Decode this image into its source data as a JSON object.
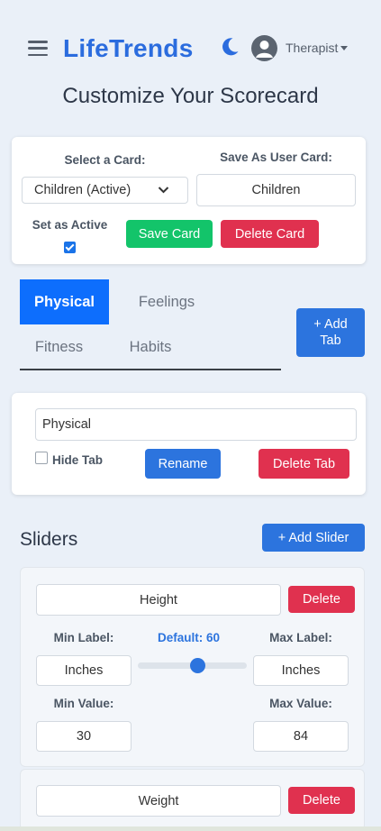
{
  "header": {
    "brand": "LifeTrends",
    "role": "Therapist",
    "menu_icon": "hamburger-menu-icon",
    "theme_icon": "moon-icon",
    "avatar_icon": "user-avatar-icon"
  },
  "page_title": "Customize Your Scorecard",
  "card_panel": {
    "select_label": "Select a Card:",
    "select_value": "Children (Active)",
    "save_as_label": "Save As User Card:",
    "save_as_value": "Children",
    "set_active_label": "Set as Active",
    "set_active_checked": true,
    "save_button": "Save Card",
    "delete_button": "Delete Card"
  },
  "tabs": {
    "items": [
      "Physical",
      "Feelings",
      "Fitness",
      "Habits"
    ],
    "active": "Physical",
    "add_tab_line1": "+ Add",
    "add_tab_line2": "Tab"
  },
  "tab_panel": {
    "name_value": "Physical",
    "hide_label": "Hide Tab",
    "hide_checked": false,
    "rename_button": "Rename",
    "delete_button": "Delete Tab"
  },
  "sliders": {
    "title": "Sliders",
    "add_button": "+ Add Slider",
    "items": [
      {
        "name": "Height",
        "delete_button": "Delete",
        "min_label_caption": "Min Label:",
        "default_caption": "Default: 60",
        "default_value": 60,
        "max_label_caption": "Max Label:",
        "min_label": "Inches",
        "max_label": "Inches",
        "min_value_caption": "Min Value:",
        "max_value_caption": "Max Value:",
        "min_value": "30",
        "max_value": "84"
      },
      {
        "name": "Weight",
        "delete_button": "Delete"
      }
    ]
  },
  "colors": {
    "brand": "#2b6cde",
    "green": "#13c46a",
    "red": "#e0314f",
    "blue": "#2c74de",
    "active_tab": "#0d6efd",
    "background": "#eaf0f8"
  }
}
